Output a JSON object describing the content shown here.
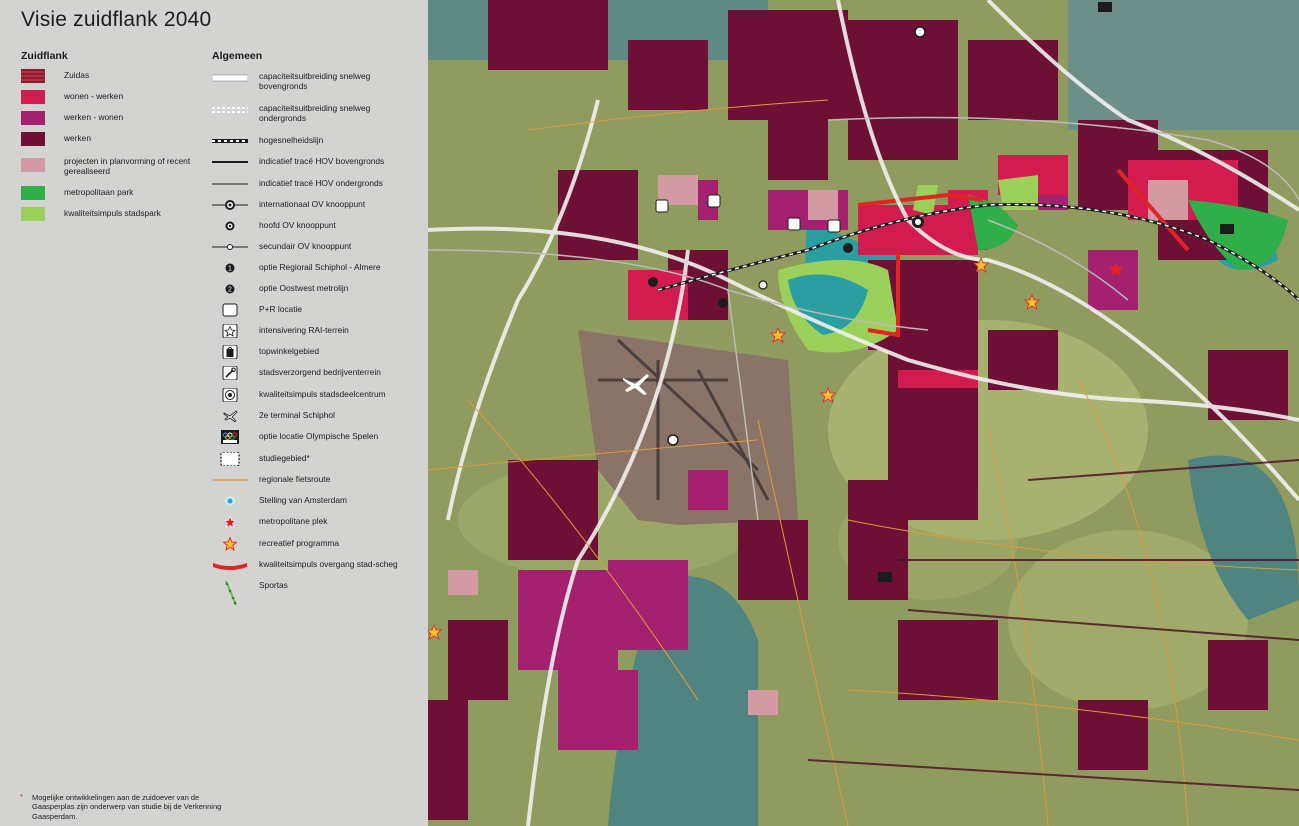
{
  "title": "Visie zuidflank 2040",
  "colors": {
    "zuidas": "#8a1c2c",
    "wonen_werken": "#d21c4f",
    "werken_wonen": "#a3216f",
    "werken": "#6e0f36",
    "projecten": "#d39aa3",
    "metropolitaan_park": "#2fae4a",
    "kwaliteitsimpuls_stadspark": "#9bd15a",
    "fietsroute": "#e09a3a",
    "overgang": "#e02424",
    "map_background": "#8c9a5e",
    "water": "#4f8480"
  },
  "zuidflank": {
    "heading": "Zuidflank",
    "items": [
      {
        "label": "Zuidas",
        "icon": "zuidas-swatch"
      },
      {
        "label": "wonen - werken",
        "icon": "wonen-werken-swatch"
      },
      {
        "label": "werken - wonen",
        "icon": "werken-wonen-swatch"
      },
      {
        "label": "werken",
        "icon": "werken-swatch"
      },
      {
        "label": "projecten in planvorming of recent gerealiseerd",
        "icon": "projecten-swatch"
      },
      {
        "label": "metropolitaan park",
        "icon": "metropolitaan-park-swatch"
      },
      {
        "label": "kwaliteitsimpuls stadspark",
        "icon": "stadspark-swatch"
      }
    ]
  },
  "algemeen": {
    "heading": "Algemeen",
    "items": [
      {
        "label": "capaciteitsuitbreiding snelweg bovengronds",
        "icon": "double-line-icon"
      },
      {
        "label": "capaciteitsuitbreiding snelweg ondergronds",
        "icon": "dashed-double-line-icon"
      },
      {
        "label": "hogesnelheidslijn",
        "icon": "hsl-line-icon"
      },
      {
        "label": "indicatief tracé HOV bovengronds",
        "icon": "solid-line-icon"
      },
      {
        "label": "indicatief tracé HOV ondergronds",
        "icon": "thin-line-icon"
      },
      {
        "label": "internationaal OV knooppunt",
        "icon": "international-node-icon"
      },
      {
        "label": "hoofd OV knooppunt",
        "icon": "main-node-icon"
      },
      {
        "label": "secundair OV knooppunt",
        "icon": "secondary-node-icon"
      },
      {
        "label": "optie Regiorail Schiphol - Almere",
        "icon": "number-1-icon",
        "glyph": "1"
      },
      {
        "label": "optie Oostwest metrolijn",
        "icon": "number-2-icon",
        "glyph": "2"
      },
      {
        "label": "P+R locatie",
        "icon": "parking-icon"
      },
      {
        "label": "intensivering RAI-terrein",
        "icon": "rai-star-icon"
      },
      {
        "label": "topwinkelgebied",
        "icon": "shopping-icon"
      },
      {
        "label": "stadsverzorgend bedrijventerrein",
        "icon": "wrench-icon"
      },
      {
        "label": "kwaliteitsimpuls stadsdeelcentrum",
        "icon": "target-icon"
      },
      {
        "label": "2e terminal Schiphol",
        "icon": "airplane-icon"
      },
      {
        "label": "optie locatie Olympische Spelen",
        "icon": "olympic-icon"
      },
      {
        "label": "studiegebied*",
        "icon": "study-area-icon"
      },
      {
        "label": "regionale fietsroute",
        "icon": "bike-route-line-icon"
      },
      {
        "label": "Stelling van Amsterdam",
        "icon": "stelling-icon"
      },
      {
        "label": "metropolitane plek",
        "icon": "red-star-icon"
      },
      {
        "label": "recreatief programma",
        "icon": "yellow-star-icon"
      },
      {
        "label": "kwaliteitsimpuls overgang stad-scheg",
        "icon": "red-bar-icon"
      },
      {
        "label": "Sportas",
        "icon": "sportas-icon"
      }
    ]
  },
  "footnote": {
    "marker": "*",
    "text": "Mogelijke ontwikkelingen aan de zuidoever van de Gaasperplas zijn onderwerp van studie bij de Verkenning Gaasperdam."
  }
}
